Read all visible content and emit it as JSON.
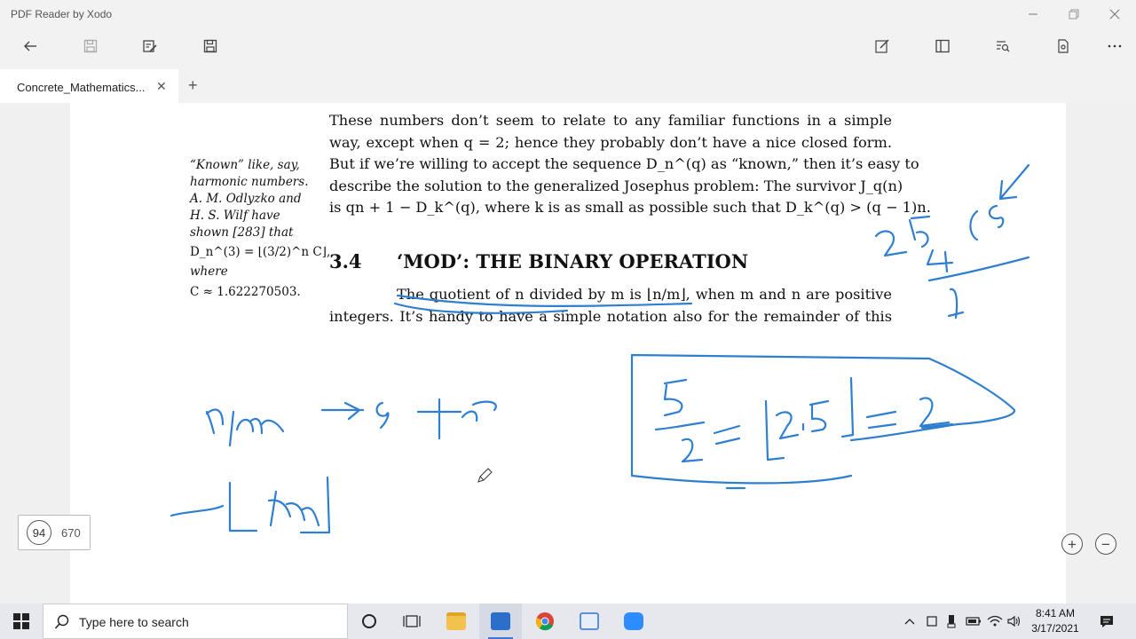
{
  "window": {
    "title": "PDF Reader by Xodo"
  },
  "tab": {
    "label": "Concrete_Mathematics...",
    "close": "✕",
    "new_tab": "+"
  },
  "document": {
    "para1_lines": [
      "These numbers don’t seem to relate to any familiar functions in a simple",
      "way, except when q = 2; hence they probably don’t have a nice closed form.",
      "But if we’re willing to accept the sequence D_n^(q) as “known,” then it’s easy to",
      "describe the solution to the generalized Josephus problem: The survivor J_q(n)",
      "is qn + 1 − D_k^(q), where k is as small as possible such that D_k^(q) > (q − 1)n."
    ],
    "margin_note": {
      "l1": "“Known” like, say,",
      "l2": "harmonic numbers.",
      "l3": "A. M. Odlyzko and",
      "l4": "H. S. Wilf have",
      "l5": "shown [283] that",
      "l6": "D_n^(3) = ⌊(3/2)^n C⌋,",
      "l7": "where",
      "l8": "C ≈ 1.622270503."
    },
    "section": {
      "number": "3.4",
      "title": "‘MOD’: THE BINARY OPERATION"
    },
    "para2_lines": [
      "The quotient of n divided by m is ⌊n/m⌋, when m and n are positive",
      "integers. It’s handy to have a simple notation also for the remainder of this"
    ]
  },
  "page_counter": {
    "current": "94",
    "total": "670"
  },
  "zoom": {
    "in": "+",
    "out": "−"
  },
  "taskbar": {
    "search_placeholder": "Type here to search",
    "time": "8:41 AM",
    "date": "3/17/2021"
  },
  "colors": {
    "ink": "#2f7fd0",
    "accent": "#3c78d8"
  }
}
